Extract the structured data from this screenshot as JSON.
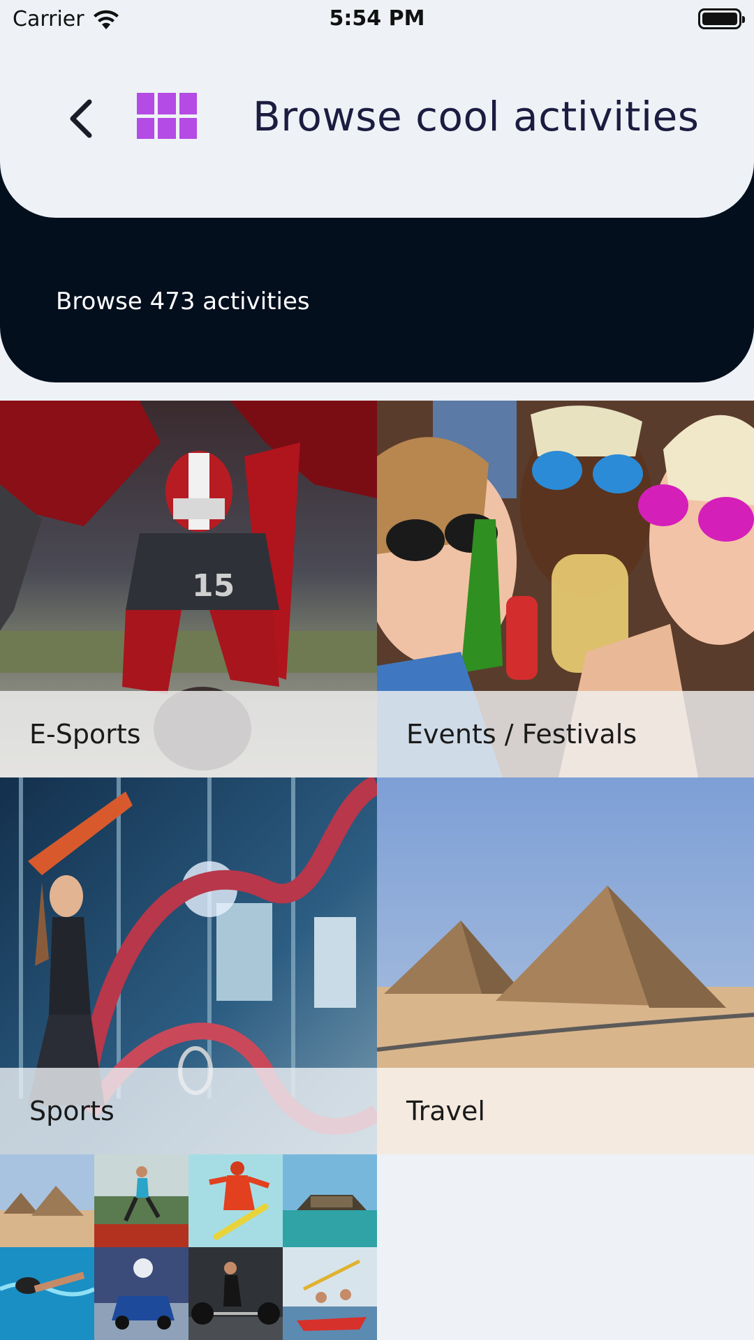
{
  "status_bar": {
    "carrier": "Carrier",
    "time": "5:54 PM"
  },
  "header": {
    "title": "Browse cool activities",
    "subtitle": "Browse 473 activities",
    "back_icon": "chevron-left-icon",
    "grid_icon": "grid-icon"
  },
  "colors": {
    "accent": "#b44be4",
    "dark_band": "#040f1e",
    "background": "#eef2f6",
    "title_text": "#1c1b40"
  },
  "categories": [
    {
      "label": "E-Sports"
    },
    {
      "label": "Events / Festivals"
    },
    {
      "label": "Sports"
    },
    {
      "label": "Travel"
    }
  ]
}
